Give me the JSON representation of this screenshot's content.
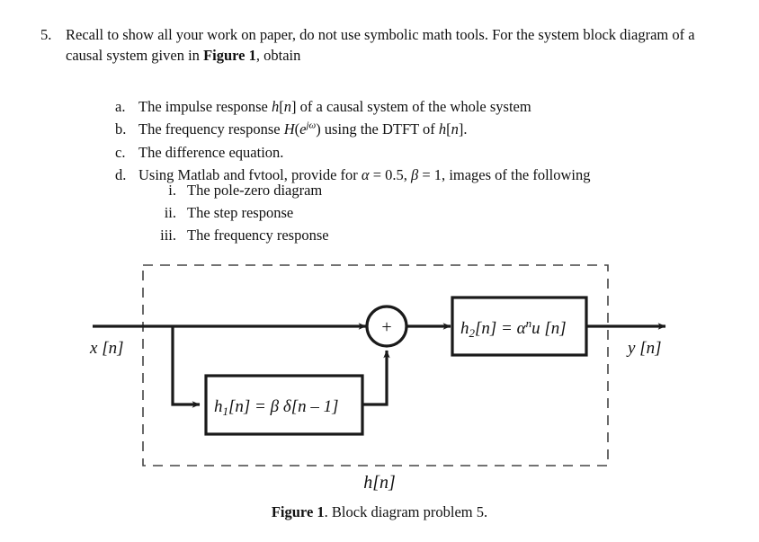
{
  "document": {
    "question": {
      "number": "5.",
      "text_part1": "Recall to show all your work on paper, do not use symbolic math tools. For the system block diagram of a causal system given in ",
      "figure_ref": "Figure 1",
      "text_part2": ", obtain"
    },
    "sub_items": [
      {
        "marker": "a.",
        "text_before": "The impulse response ",
        "math1": "h",
        "math1_rest": "[",
        "math2": "n",
        "math2_rest": "]",
        "text_after": " of a causal system of the whole system"
      },
      {
        "marker": "b.",
        "text_before": "The frequency response ",
        "math1": "H",
        "math1_rest": "(",
        "math2": "e",
        "math2_sup": "jω",
        "math2_rest": ") using the DTFT of ",
        "math3": "h",
        "math3_rest": "[",
        "math4": "n",
        "text_after": "]."
      },
      {
        "marker": "c.",
        "text": "The difference equation."
      },
      {
        "marker": "d.",
        "text_before": "Using Matlab and fvtool, provide for ",
        "alpha": "α",
        "alpha_eq": " = 0.5, ",
        "beta": "β",
        "beta_eq": " = 1, ",
        "text_after": "images of the following"
      }
    ],
    "roman_items": [
      {
        "marker": "i.",
        "text": "The pole-zero diagram"
      },
      {
        "marker": "ii.",
        "text": "The step response"
      },
      {
        "marker": "iii.",
        "text": "The frequency response"
      }
    ],
    "figure": {
      "input_label": "x[n]",
      "output_label": "y[n]",
      "system_label": "h[n]",
      "summer_symbol": "+",
      "block_h1": "h₁[n] = β δ[n − 1]",
      "block_h1_parts": {
        "name": "h",
        "sub": "1",
        "bracket_n": "[n] = ",
        "beta": "β",
        "delta": " δ",
        "arg": "[n − 1]"
      },
      "block_h2": "h₂[n] = αⁿu[n]",
      "block_h2_parts": {
        "name": "h",
        "sub": "2",
        "bracket_n": "[n] = ",
        "alpha": "α",
        "exp": "n",
        "u": "u",
        "arg": "[n]"
      },
      "caption_bold": "Figure 1",
      "caption_rest": ". Block diagram problem 5."
    },
    "colors": {
      "background": "#ffffff",
      "text": "#111111",
      "line": "#1a1a1a",
      "dashed_border": "#444444"
    }
  }
}
